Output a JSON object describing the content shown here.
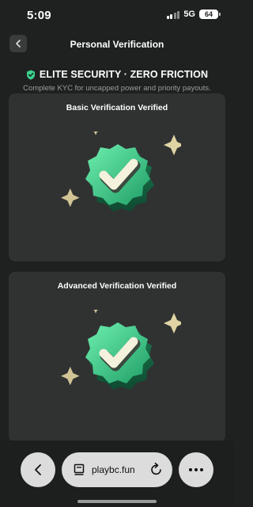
{
  "status": {
    "time": "5:09",
    "network": "5G",
    "battery": "64"
  },
  "nav": {
    "title": "Personal Verification"
  },
  "header": {
    "badge_text": "ELITE SECURITY · ZERO FRICTION",
    "subtitle": "Complete KYC for uncapped power and priority payouts."
  },
  "cards": [
    {
      "title": "Basic Verification Verified",
      "status": "verified"
    },
    {
      "title": "Advanced Verification Verified",
      "status": "verified"
    }
  ],
  "browser": {
    "url": "playbc.fun"
  },
  "colors": {
    "accent_green": "#3fcf8e",
    "sparkle_gold": "#e0d4a4",
    "card_bg": "#303232"
  }
}
